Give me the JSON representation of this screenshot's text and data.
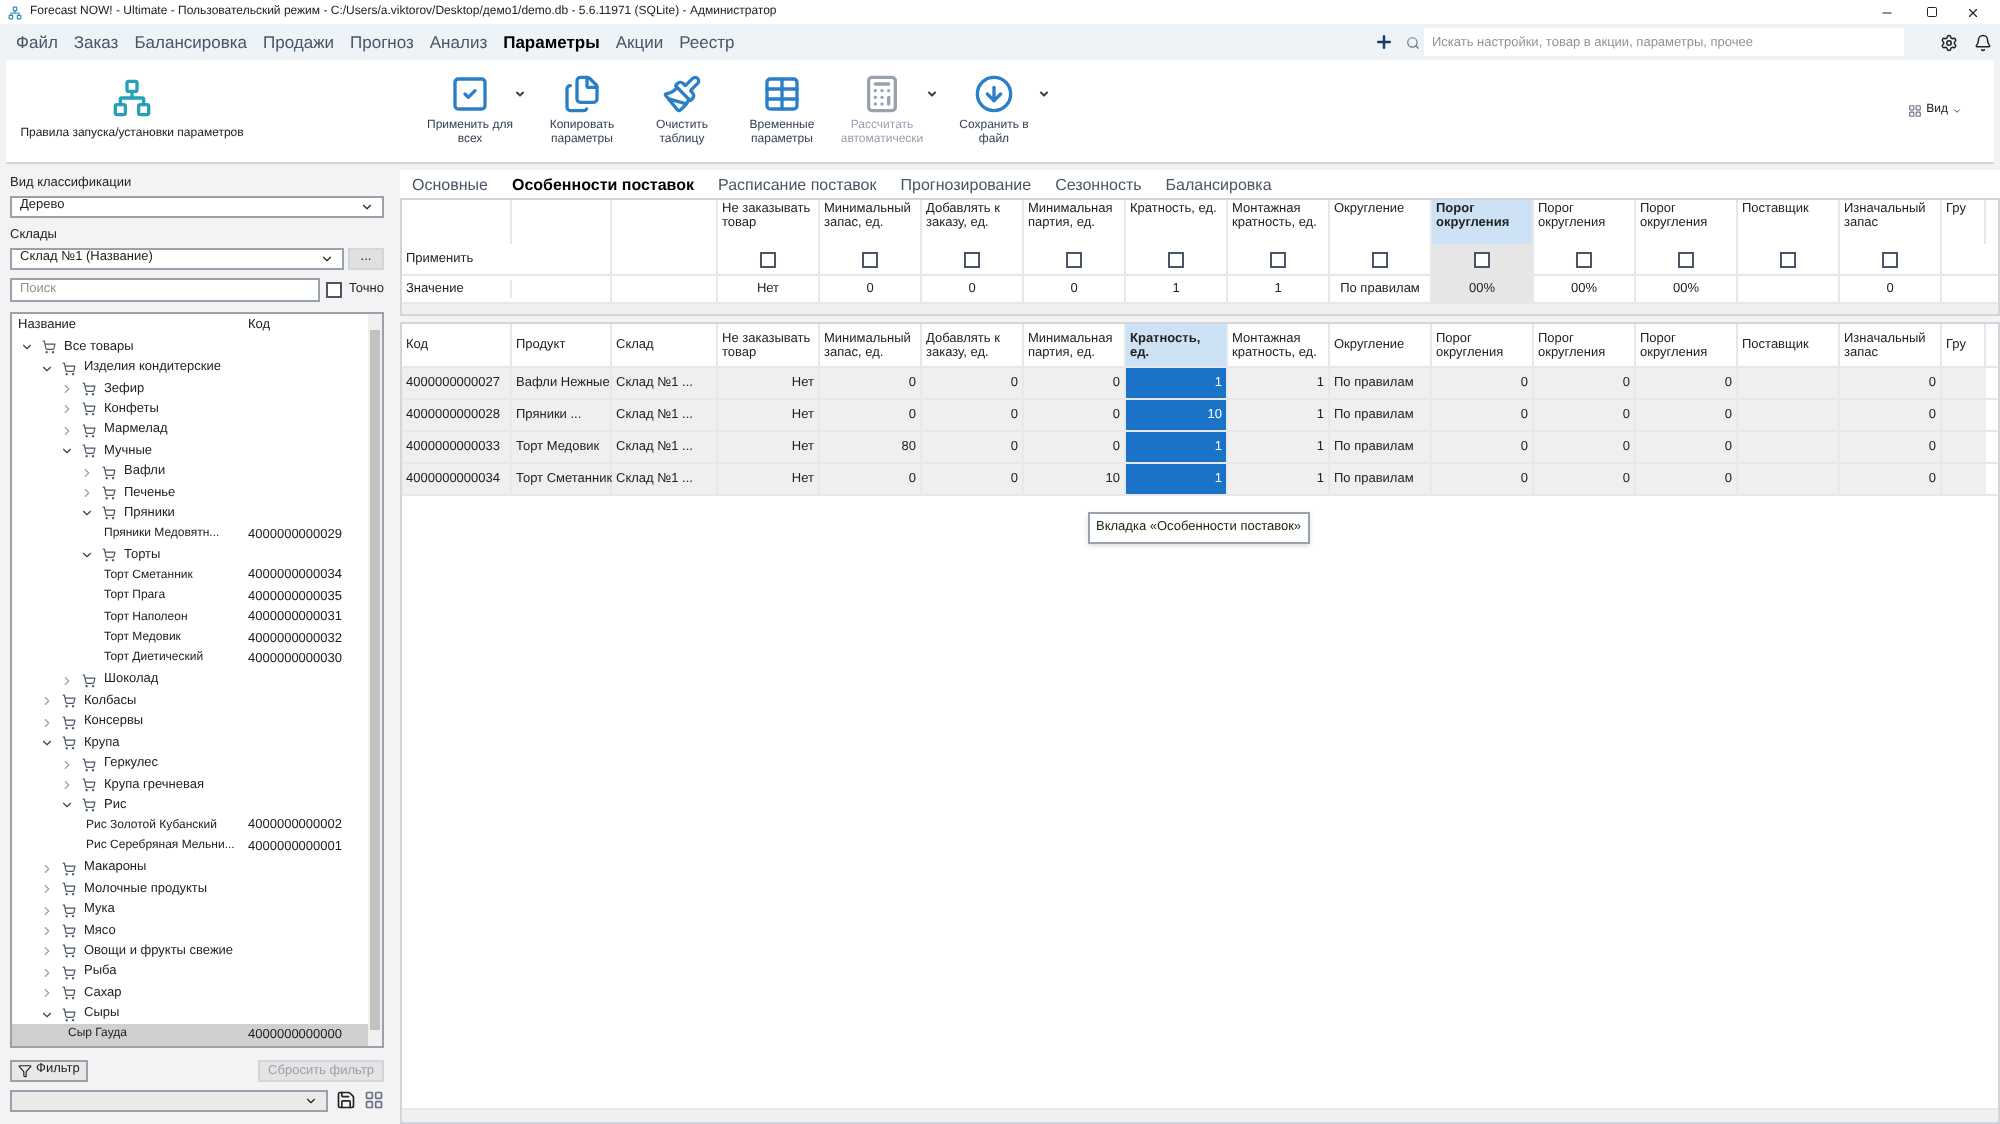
{
  "window": {
    "title": "Forecast NOW! - Ultimate - Пользовательский режим - C:/Users/a.viktorov/Desktop/демо1/demo.db - 5.6.11971 (SQLite) - Администратор"
  },
  "menu": [
    {
      "label": "Файл",
      "selected": false
    },
    {
      "label": "Заказ",
      "selected": false
    },
    {
      "label": "Балансировка",
      "selected": false
    },
    {
      "label": "Продажи",
      "selected": false
    },
    {
      "label": "Прогноз",
      "selected": false
    },
    {
      "label": "Анализ",
      "selected": false
    },
    {
      "label": "Параметры",
      "selected": true
    },
    {
      "label": "Акции",
      "selected": false
    },
    {
      "label": "Реестр",
      "selected": false
    }
  ],
  "search": {
    "placeholder": "Искать настройки, товар в акции, параметры, прочее"
  },
  "ribbon": {
    "rules_button": {
      "label": "Правила запуска/установки параметров"
    },
    "buttons": [
      {
        "label": "Применить для всех",
        "dropdown": true,
        "disabled": false
      },
      {
        "label": "Копировать параметры",
        "dropdown": false,
        "disabled": false
      },
      {
        "label": "Очистить таблицу",
        "dropdown": false,
        "disabled": false
      },
      {
        "label": "Временные параметры",
        "dropdown": false,
        "disabled": false
      },
      {
        "label": "Рассчитать автоматически",
        "dropdown": true,
        "disabled": true
      },
      {
        "label": "Сохранить в файл",
        "dropdown": true,
        "disabled": false
      }
    ],
    "view_button": {
      "label": "Вид"
    }
  },
  "left_panel": {
    "classification": {
      "label": "Вид классификации",
      "value": "Дерево"
    },
    "warehouses": {
      "label": "Склады",
      "value": "Склад №1 (Название)",
      "more_button": "..."
    },
    "search": {
      "placeholder": "Поиск"
    },
    "exact": {
      "label": "Точно",
      "checked": false
    },
    "tree": {
      "columns": [
        "Название",
        "Код"
      ],
      "items": [
        {
          "label": "Все товары",
          "kind": "group",
          "expanded": true,
          "selected": false,
          "children": [
            {
              "label": "Изделия кондитерские",
              "kind": "group",
              "expanded": true,
              "selected": false,
              "children": [
                {
                  "label": "Зефир",
                  "kind": "group",
                  "expanded": false,
                  "selected": false
                },
                {
                  "label": "Конфеты",
                  "kind": "group",
                  "expanded": false,
                  "selected": false
                },
                {
                  "label": "Мармелад",
                  "kind": "group",
                  "expanded": false,
                  "selected": false
                },
                {
                  "label": "Мучные",
                  "kind": "group",
                  "expanded": true,
                  "selected": false,
                  "children": [
                    {
                      "label": "Вафли",
                      "kind": "group",
                      "expanded": false,
                      "selected": false
                    },
                    {
                      "label": "Печенье",
                      "kind": "group",
                      "expanded": false,
                      "selected": false
                    },
                    {
                      "label": "Пряники",
                      "kind": "group",
                      "expanded": true,
                      "selected": false,
                      "children": [
                        {
                          "label": "Пряники Медовятн...",
                          "kind": "item",
                          "code": "4000000000029",
                          "selected": false
                        }
                      ]
                    },
                    {
                      "label": "Торты",
                      "kind": "group",
                      "expanded": true,
                      "selected": false,
                      "children": [
                        {
                          "label": "Торт Сметанник",
                          "kind": "item",
                          "code": "4000000000034",
                          "selected": false
                        },
                        {
                          "label": "Торт Прага",
                          "kind": "item",
                          "code": "4000000000035",
                          "selected": false
                        },
                        {
                          "label": "Торт Наполеон",
                          "kind": "item",
                          "code": "4000000000031",
                          "selected": false
                        },
                        {
                          "label": "Торт Медовик",
                          "kind": "item",
                          "code": "4000000000032",
                          "selected": false
                        },
                        {
                          "label": "Торт Диетический",
                          "kind": "item",
                          "code": "4000000000030",
                          "selected": false
                        }
                      ]
                    }
                  ]
                },
                {
                  "label": "Шоколад",
                  "kind": "group",
                  "expanded": false,
                  "selected": false
                }
              ]
            },
            {
              "label": "Колбасы",
              "kind": "group",
              "expanded": false,
              "selected": false
            },
            {
              "label": "Консервы",
              "kind": "group",
              "expanded": false,
              "selected": false
            },
            {
              "label": "Крупа",
              "kind": "group",
              "expanded": true,
              "selected": false,
              "children": [
                {
                  "label": "Геркулес",
                  "kind": "group",
                  "expanded": false,
                  "selected": false
                },
                {
                  "label": "Крупа гречневая",
                  "kind": "group",
                  "expanded": false,
                  "selected": false
                },
                {
                  "label": "Рис",
                  "kind": "group",
                  "expanded": true,
                  "selected": false,
                  "children": [
                    {
                      "label": "Рис Золотой Кубанский",
                      "kind": "item",
                      "code": "4000000000002",
                      "selected": false
                    },
                    {
                      "label": "Рис Серебряная Мельни...",
                      "kind": "item",
                      "code": "4000000000001",
                      "selected": false
                    }
                  ]
                }
              ]
            },
            {
              "label": "Макароны",
              "kind": "group",
              "expanded": false,
              "selected": false
            },
            {
              "label": "Молочные продукты",
              "kind": "group",
              "expanded": false,
              "selected": false
            },
            {
              "label": "Мука",
              "kind": "group",
              "expanded": false,
              "selected": false
            },
            {
              "label": "Мясо",
              "kind": "group",
              "expanded": false,
              "selected": false
            },
            {
              "label": "Овощи и фрукты свежие",
              "kind": "group",
              "expanded": false,
              "selected": false
            },
            {
              "label": "Рыба",
              "kind": "group",
              "expanded": false,
              "selected": false
            },
            {
              "label": "Сахар",
              "kind": "group",
              "expanded": false,
              "selected": false
            },
            {
              "label": "Сыры",
              "kind": "group",
              "expanded": true,
              "selected": false,
              "children": [
                {
                  "label": "Сыр Гауда",
                  "kind": "item",
                  "code": "4000000000000",
                  "selected": true
                }
              ]
            }
          ]
        }
      ]
    },
    "filter_button": {
      "label": "Фильтр"
    },
    "reset_button": {
      "label": "Сбросить фильтр",
      "disabled": true
    }
  },
  "tabs": [
    {
      "label": "Основные",
      "selected": false
    },
    {
      "label": "Особенности поставок",
      "selected": true
    },
    {
      "label": "Расписание поставок",
      "selected": false
    },
    {
      "label": "Прогнозирование",
      "selected": false
    },
    {
      "label": "Сезонность",
      "selected": false
    },
    {
      "label": "Балансировка",
      "selected": false
    }
  ],
  "settings_grid": {
    "columns": [
      {
        "label": "Не заказывать товар",
        "selected": false
      },
      {
        "label": "Минимальный запас, ед.",
        "selected": false
      },
      {
        "label": "Добавлять к заказу, ед.",
        "selected": false
      },
      {
        "label": "Минимальная партия, ед.",
        "selected": false
      },
      {
        "label": "Кратность, ед.",
        "selected": false
      },
      {
        "label": "Монтажная кратность, ед.",
        "selected": false
      },
      {
        "label": "Округление",
        "selected": false
      },
      {
        "label": "Порог округления",
        "selected": true
      },
      {
        "label": "Порог округления",
        "selected": false
      },
      {
        "label": "Порог округления",
        "selected": false
      },
      {
        "label": "Поставщик",
        "selected": false
      },
      {
        "label": "Изначальный запас",
        "selected": false
      },
      {
        "label": "Гру",
        "selected": false
      }
    ],
    "apply_row": {
      "label": "Применить",
      "cells": [
        {
          "checked": false
        },
        {
          "checked": false
        },
        {
          "checked": false
        },
        {
          "checked": false
        },
        {
          "checked": false
        },
        {
          "checked": false
        },
        {
          "checked": false
        },
        {
          "checked": false
        },
        {
          "checked": false
        },
        {
          "checked": false
        },
        {
          "checked": false
        },
        {
          "checked": false
        }
      ]
    },
    "value_row": {
      "label": "Значение",
      "cells": [
        "Нет",
        "0",
        "0",
        "0",
        "1",
        "1",
        "По правилам",
        "00%",
        "00%",
        "00%",
        null,
        "0"
      ]
    }
  },
  "products_grid": {
    "columns": [
      {
        "label": "Код",
        "selected": false
      },
      {
        "label": "Продукт",
        "selected": false
      },
      {
        "label": "Склад",
        "selected": false
      },
      {
        "label": "Не заказывать товар",
        "selected": false
      },
      {
        "label": "Минимальный запас, ед.",
        "selected": false
      },
      {
        "label": "Добавлять к заказу, ед.",
        "selected": false
      },
      {
        "label": "Минимальная партия, ед.",
        "selected": false
      },
      {
        "label": "Кратность, ед.",
        "selected": true
      },
      {
        "label": "Монтажная кратность, ед.",
        "selected": false
      },
      {
        "label": "Округление",
        "selected": false
      },
      {
        "label": "Порог округления",
        "selected": false
      },
      {
        "label": "Порог округления",
        "selected": false
      },
      {
        "label": "Порог округления",
        "selected": false
      },
      {
        "label": "Поставщик",
        "selected": false
      },
      {
        "label": "Изначальный запас",
        "selected": false
      },
      {
        "label": "Гру",
        "selected": false
      }
    ],
    "rows": [
      {
        "cells": [
          "4000000000027",
          "Вафли Нежные",
          "Склад №1 ...",
          "Нет",
          "0",
          "0",
          "0",
          "1",
          "1",
          "По правилам",
          "0",
          "0",
          "0",
          null,
          "0"
        ]
      },
      {
        "cells": [
          "4000000000028",
          "Пряники ...",
          "Склад №1 ...",
          "Нет",
          "0",
          "0",
          "0",
          "10",
          "1",
          "По правилам",
          "0",
          "0",
          "0",
          null,
          "0"
        ]
      },
      {
        "cells": [
          "4000000000033",
          "Торт Медовик",
          "Склад №1 ...",
          "Нет",
          "80",
          "0",
          "0",
          "1",
          "1",
          "По правилам",
          "0",
          "0",
          "0",
          null,
          "0"
        ]
      },
      {
        "cells": [
          "4000000000034",
          "Торт Сметанник",
          "Склад №1 ...",
          "Нет",
          "0",
          "0",
          "10",
          "1",
          "1",
          "По правилам",
          "0",
          "0",
          "0",
          null,
          "0"
        ]
      }
    ]
  },
  "tooltip": {
    "text": "Вкладка «Особенности поставок»"
  }
}
